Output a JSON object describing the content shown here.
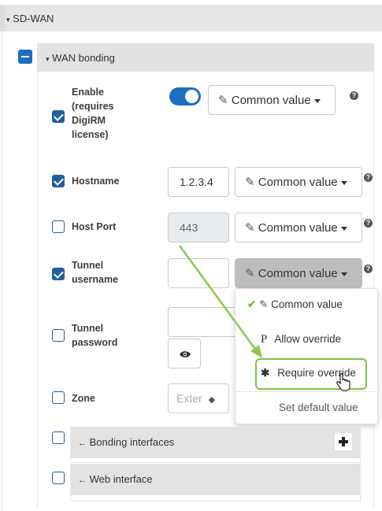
{
  "section": {
    "title": "SD-WAN"
  },
  "group": {
    "title": "WAN bonding"
  },
  "fields": {
    "enable": {
      "label": "Enable (requires DigiRM license)",
      "checked": true,
      "toggle_on": true,
      "value_mode": "Common value"
    },
    "hostname": {
      "label": "Hostname",
      "checked": true,
      "value": "1.2.3.4",
      "value_mode": "Common value"
    },
    "host_port": {
      "label": "Host Port",
      "checked": false,
      "value": "443",
      "value_mode": "Common value"
    },
    "tunnel_username": {
      "label": "Tunnel username",
      "checked": true,
      "value": "",
      "value_mode": "Common value"
    },
    "tunnel_password": {
      "label": "Tunnel password",
      "checked": false,
      "value": ""
    },
    "zone": {
      "label": "Zone",
      "checked": false,
      "value": "Exter"
    }
  },
  "value_menu": {
    "items": [
      {
        "label": "Common value",
        "icon": "edit-icon",
        "selected": true
      },
      {
        "label": "Allow override",
        "icon": "p-override-icon"
      },
      {
        "label": "Require override",
        "icon": "asterisk-icon",
        "highlighted": true
      },
      {
        "label": "Set default value"
      }
    ]
  },
  "subsections": [
    {
      "label": "Bonding interfaces",
      "has_add": true
    },
    {
      "label": "Web interface"
    }
  ],
  "colors": {
    "accent": "#1b6fc0",
    "checkbox": "#1f5f9e",
    "highlight": "#7fc241",
    "check_mark": "#6cbf3a"
  }
}
